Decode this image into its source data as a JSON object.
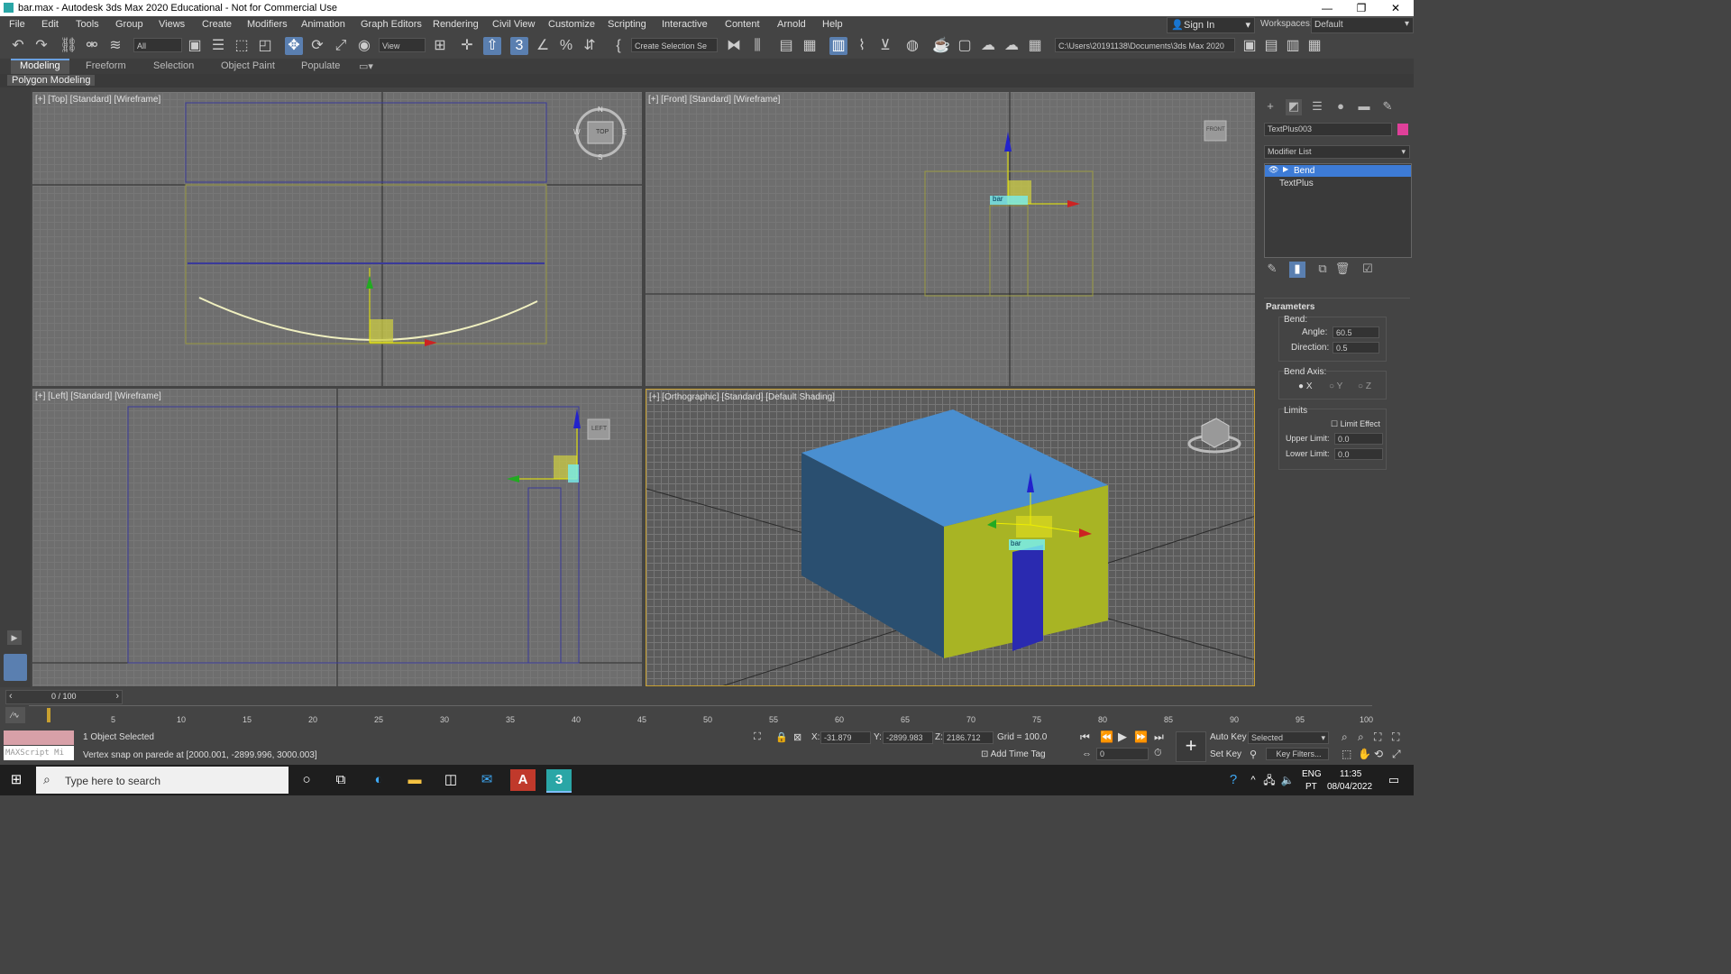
{
  "window": {
    "title": "bar.max - Autodesk 3ds Max 2020 Educational - Not for Commercial Use",
    "min": "—",
    "max": "❐",
    "close": "✕"
  },
  "menu": [
    "File",
    "Edit",
    "Tools",
    "Group",
    "Views",
    "Create",
    "Modifiers",
    "Animation",
    "Graph Editors",
    "Rendering",
    "Civil View",
    "Customize",
    "Scripting",
    "Interactive",
    "Content",
    "Arnold",
    "Help"
  ],
  "signin": "Sign In",
  "workspace": {
    "label": "Workspaces:",
    "value": "Default"
  },
  "toolbar": {
    "filter": "All",
    "refcoord": "View",
    "selset": "Create Selection Se",
    "path": "C:\\Users\\20191138\\Documents\\3ds Max 2020"
  },
  "ribbon": {
    "tabs": [
      "Modeling",
      "Freeform",
      "Selection",
      "Object Paint",
      "Populate"
    ],
    "sub": "Polygon Modeling"
  },
  "viewports": {
    "top": "[+] [Top] [Standard] [Wireframe]",
    "front": "[+] [Front] [Standard] [Wireframe]",
    "left": "[+] [Left] [Standard] [Wireframe]",
    "persp": "[+] [Orthographic] [Standard] [Default Shading]"
  },
  "viewcube": {
    "top": "TOP",
    "front": "FRONT",
    "left": "LEFT",
    "n": "N",
    "s": "S",
    "e": "E",
    "w": "W"
  },
  "object_label": "bar",
  "command_panel": {
    "object_name": "TextPlus003",
    "object_color": "#e0409a",
    "modifier_list": "Modifier List",
    "stack": [
      "Bend",
      "TextPlus"
    ],
    "rollout": "Parameters",
    "bend_label": "Bend:",
    "angle_label": "Angle:",
    "angle": "60.5",
    "direction_label": "Direction:",
    "direction": "0.5",
    "axis_label": "Bend Axis:",
    "axes": [
      "X",
      "Y",
      "Z"
    ],
    "limits_label": "Limits",
    "limit_effect": "Limit Effect",
    "upper_label": "Upper Limit:",
    "upper": "0.0",
    "lower_label": "Lower Limit:",
    "lower": "0.0"
  },
  "timeline": {
    "frame": "0 / 100",
    "ticks": [
      "5",
      "10",
      "15",
      "20",
      "25",
      "30",
      "35",
      "40",
      "45",
      "50",
      "55",
      "60",
      "65",
      "70",
      "75",
      "80",
      "85",
      "90",
      "95",
      "100"
    ]
  },
  "status": {
    "maxscript": "MAXScript Mi",
    "selected": "1 Object Selected",
    "prompt": "Vertex snap on parede at [2000.001, -2899.996, 3000.003]",
    "x_label": "X:",
    "x": "-31.879",
    "y_label": "Y:",
    "y": "-2899.983",
    "z_label": "Z:",
    "z": "2186.712",
    "grid": "Grid = 100.0",
    "add_time_tag": "Add Time Tag",
    "autokey": "Auto Key",
    "setkey": "Set Key",
    "keymode": "Selected",
    "keyfilters": "Key Filters...",
    "frame_field": "0"
  },
  "taskbar": {
    "search": "Type here to search",
    "lang1": "ENG",
    "lang2": "PT",
    "time": "11:35",
    "date": "08/04/2022"
  },
  "colors": {
    "accent": "#5a7fb0",
    "selection": "#3d7bd6"
  }
}
